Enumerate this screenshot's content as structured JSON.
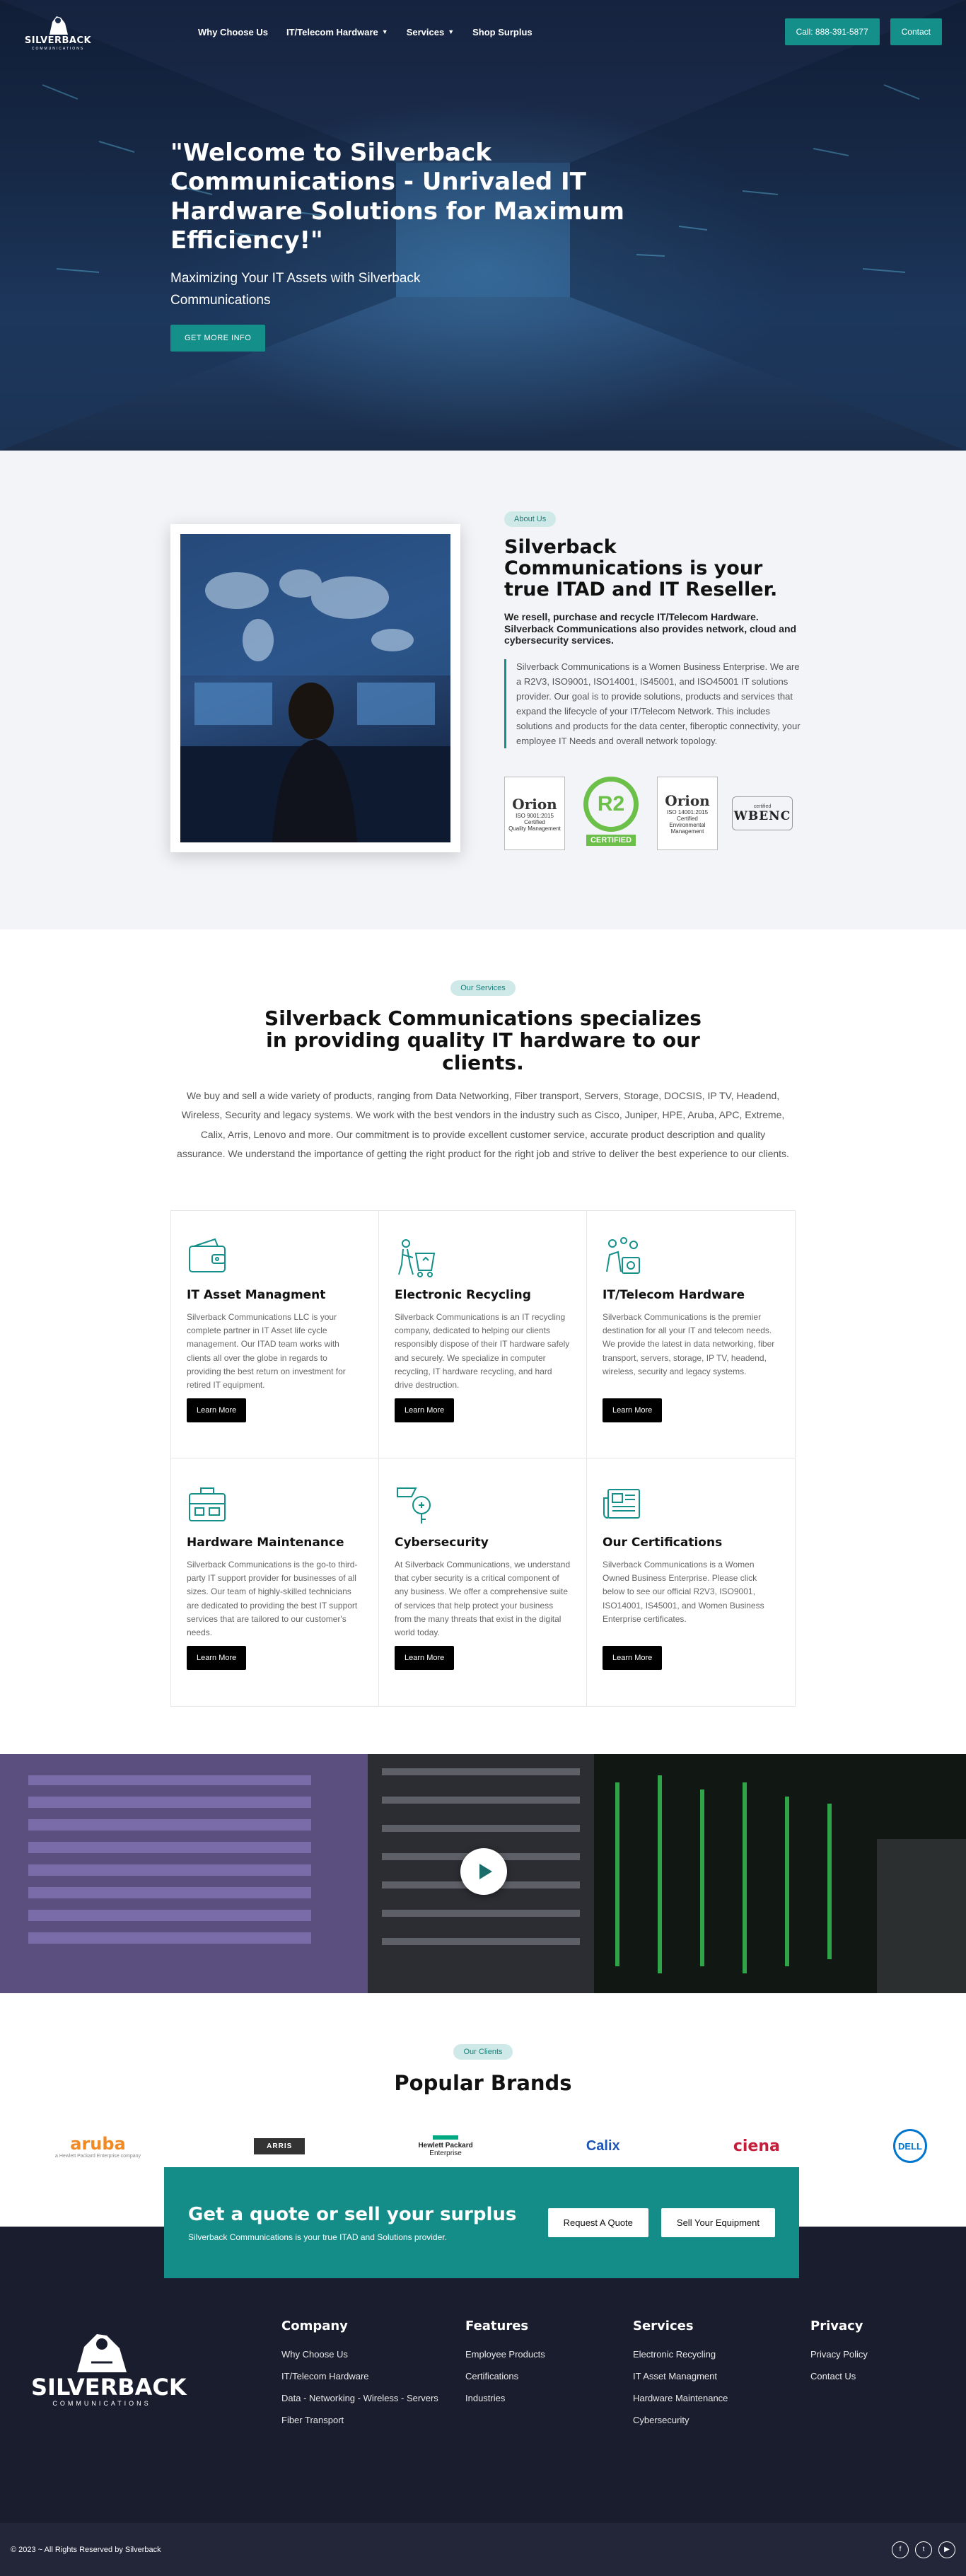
{
  "header": {
    "logo": {
      "brand": "SILVERBACK",
      "sub": "COMMUNICATIONS"
    },
    "nav": [
      {
        "label": "Why Choose Us",
        "has_dropdown": false
      },
      {
        "label": "IT/Telecom Hardware",
        "has_dropdown": true
      },
      {
        "label": "Services",
        "has_dropdown": true
      },
      {
        "label": "Shop Surplus",
        "has_dropdown": false
      }
    ],
    "call_label": "Call: 888-391-5877",
    "contact_label": "Contact"
  },
  "hero": {
    "title": "\"Welcome to Silverback Communications - Unrivaled IT Hardware Solutions for Maximum Efficiency!\"",
    "subtitle": "Maximizing Your IT Assets with Silverback Communications",
    "cta_label": "GET MORE INFO"
  },
  "about": {
    "pill": "About Us",
    "title": "Silverback Communications is your true ITAD and IT Reseller.",
    "lead": "We resell, purchase and recycle IT/Telecom Hardware. Silverback Communications also provides network, cloud and cybersecurity services.",
    "quote": "Silverback Communications is a Women Business Enterprise. We are a R2V3, ISO9001, ISO14001, IS45001, and ISO45001 IT solutions provider. Our goal is to provide solutions, products and services that expand the lifecycle of your IT/Telecom Network. This includes solutions and products for the data center, fiberoptic connectivity, your employee IT Needs and overall network topology.",
    "certs": [
      {
        "name": "Orion",
        "line1": "ISO 9001:2015",
        "line2": "Certified",
        "line3": "Quality Management"
      },
      {
        "name": "R2",
        "line1": "v3",
        "tag": "CERTIFIED"
      },
      {
        "name": "Orion",
        "line1": "ISO 14001:2015",
        "line2": "Certified",
        "line3": "Environmental Management"
      },
      {
        "name": "WBENC",
        "line1": "certified"
      }
    ]
  },
  "services": {
    "pill": "Our Services",
    "title": "Silverback Communications specializes in providing quality IT hardware to our clients.",
    "intro": "We buy and sell a wide variety of products, ranging from Data Networking, Fiber transport, Servers, Storage, DOCSIS, IP TV, Headend, Wireless, Security and legacy systems. We work with the best vendors in the industry such as Cisco, Juniper, HPE, Aruba, APC, Extreme, Calix, Arris, Lenovo and more. Our commitment is to provide excellent customer service, accurate product description and quality assurance. We understand the importance of getting the right product for the right job and strive to deliver the best experience to our clients.",
    "cards": [
      {
        "icon": "wallet-icon",
        "title": "IT Asset Managment",
        "text": "Silverback Communications LLC is your complete partner in IT Asset life cycle management. Our ITAD team works with clients all over the globe in regards to providing the best return on investment for retired IT equipment.",
        "button": "Learn More"
      },
      {
        "icon": "recycling-icon",
        "title": "Electronic Recycling",
        "text": "Silverback Communications is an IT recycling company, dedicated to helping our clients responsibly dispose of their IT hardware safely and securely. We specialize in computer recycling, IT hardware recycling, and hard drive destruction.",
        "button": "Learn More"
      },
      {
        "icon": "hardware-icon",
        "title": "IT/Telecom Hardware",
        "text": "Silverback Communications is the premier destination for all your IT and telecom needs. We provide the latest in data networking, fiber transport, servers, storage, IP TV, headend, wireless, security and legacy systems.",
        "button": "Learn More"
      },
      {
        "icon": "toolbox-icon",
        "title": "Hardware Maintenance",
        "text": "Silverback Communications is the go-to third-party IT support provider for businesses of all sizes. Our team of highly-skilled technicians are dedicated to providing the best IT support services that are tailored to our customer's needs.",
        "button": "Learn More"
      },
      {
        "icon": "key-lock-icon",
        "title": "Cybersecurity",
        "text": "At Silverback Communications, we understand that cyber security is a critical component of any business. We offer a comprehensive suite of services that help protect your business from the many threats that exist in the digital world today.",
        "button": "Learn More"
      },
      {
        "icon": "newspaper-icon",
        "title": "Our Certifications",
        "text": "Silverback Communications is a Women Owned Business Enterprise. Please click below to see our official R2V3, ISO9001, ISO14001, IS45001, and Women Business Enterprise certificates.",
        "button": "Learn More"
      }
    ]
  },
  "brands": {
    "pill": "Our Clients",
    "title": "Popular Brands",
    "logos": [
      {
        "name": "aruba",
        "sub": "a Hewlett Packard Enterprise company"
      },
      {
        "name": "ARRIS"
      },
      {
        "name": "Hewlett Packard",
        "sub": "Enterprise"
      },
      {
        "name": "Calix"
      },
      {
        "name": "ciena"
      },
      {
        "name": "DELL"
      }
    ]
  },
  "cta": {
    "title": "Get a quote or sell your surplus",
    "text": "Silverback Communications is your true ITAD and Solutions provider.",
    "quote_button": "Request A Quote",
    "sell_button": "Sell Your Equipment"
  },
  "footer": {
    "columns": [
      {
        "title": "Company",
        "links": [
          "Why Choose Us",
          "IT/Telecom Hardware",
          "Data - Networking - Wireless - Servers",
          "Fiber Transport"
        ]
      },
      {
        "title": "Features",
        "links": [
          "Employee Products",
          "Certifications",
          "Industries"
        ]
      },
      {
        "title": "Services",
        "links": [
          "Electronic Recycling",
          "IT Asset Managment",
          "Hardware Maintenance",
          "Cybersecurity"
        ]
      },
      {
        "title": "Privacy",
        "links": [
          "Privacy Policy",
          "Contact Us"
        ]
      }
    ],
    "copyright": "© 2023 ~ All Rights Reserved by Silverback",
    "socials": [
      "facebook-icon",
      "twitter-icon",
      "youtube-icon"
    ]
  },
  "colors": {
    "accent": "#158f8a",
    "dark": "#1a1d2e",
    "pill_bg": "#cfe9e8"
  }
}
